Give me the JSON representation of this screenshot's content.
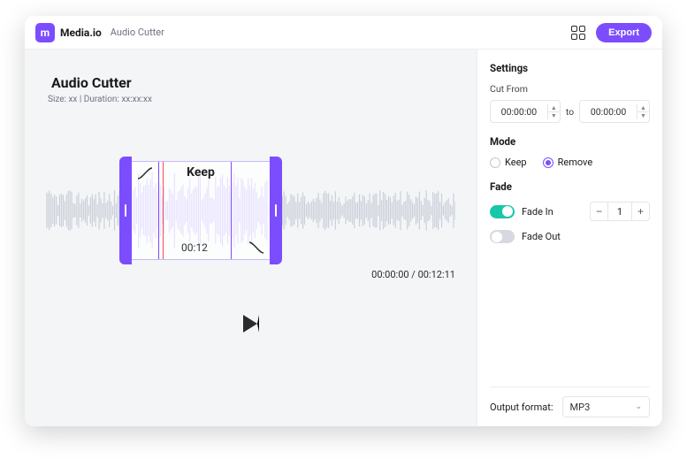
{
  "header": {
    "brand": "Media.io",
    "page": "Audio Cutter",
    "export_label": "Export"
  },
  "main": {
    "title": "Audio Cutter",
    "meta": "Size: xx | Duration: xx:xx:xx",
    "selection_label": "Keep",
    "selection_time": "00:12",
    "time_readout": "00:00:00 / 00:12:11"
  },
  "sidebar": {
    "settings_title": "Settings",
    "cut_from_label": "Cut From",
    "from_value": "00:00:00",
    "to_label": "to",
    "to_value": "00:00:00",
    "mode_title": "Mode",
    "mode_keep_label": "Keep",
    "mode_remove_label": "Remove",
    "mode_selected": "remove",
    "fade_title": "Fade",
    "fade_in_label": "Fade In",
    "fade_in_on": true,
    "fade_in_value": "1",
    "fade_out_label": "Fade Out",
    "fade_out_on": false,
    "output_label": "Output format:",
    "output_value": "MP3"
  }
}
